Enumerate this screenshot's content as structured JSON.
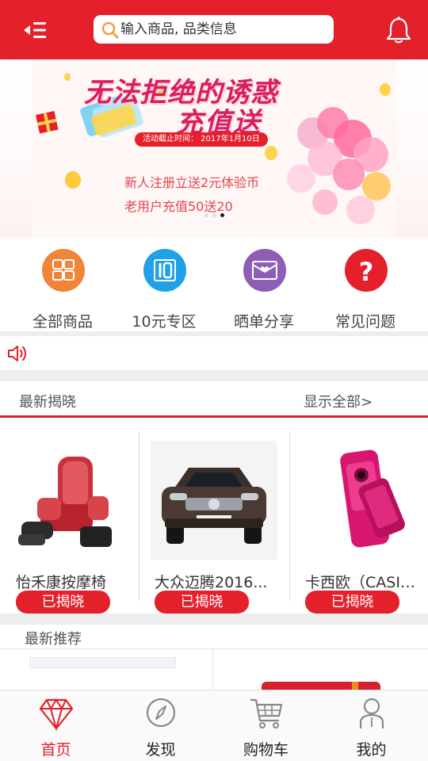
{
  "header": {
    "search_placeholder": "输入商品, 品类信息",
    "menu_icon": "back-list-icon",
    "bell_icon": "bell-icon"
  },
  "banner": {
    "title_line1": "无法拒绝的诱惑",
    "title_line2": "充值送",
    "date_text": "活动截止时间： 2017年1月10日",
    "promo_line1": "新人注册立送2元体验币",
    "promo_line2": "老用户充值50送20",
    "slide_count": 3,
    "active_slide": 3
  },
  "categories": [
    {
      "label": "全部商品",
      "icon": "grid-icon",
      "color": "#f0853a"
    },
    {
      "label": "10元专区",
      "icon": "ten-yuan-icon",
      "color": "#1ea1e6"
    },
    {
      "label": "晒单分享",
      "icon": "envelope-heart-icon",
      "color": "#8e5db8"
    },
    {
      "label": "常见问题",
      "icon": "question-icon",
      "color": "#e4202b"
    }
  ],
  "notice": {
    "icon": "speaker-icon"
  },
  "latest": {
    "title": "最新揭晓",
    "more": "显示全部>",
    "products": [
      {
        "name": "怡禾康按摩椅",
        "button": "已揭晓"
      },
      {
        "name": "大众迈腾2016...",
        "button": "已揭晓"
      },
      {
        "name": "卡西欧（CASIO...",
        "button": "已揭晓"
      }
    ]
  },
  "recommend": {
    "title": "最新推荐"
  },
  "bottom_nav": [
    {
      "label": "首页",
      "icon": "diamond-icon",
      "active": true
    },
    {
      "label": "发现",
      "icon": "compass-icon",
      "active": false
    },
    {
      "label": "购物车",
      "icon": "cart-icon",
      "active": false
    },
    {
      "label": "我的",
      "icon": "user-icon",
      "active": false
    }
  ],
  "colors": {
    "brand_red": "#e4202b",
    "divider": "#eeeeee"
  }
}
